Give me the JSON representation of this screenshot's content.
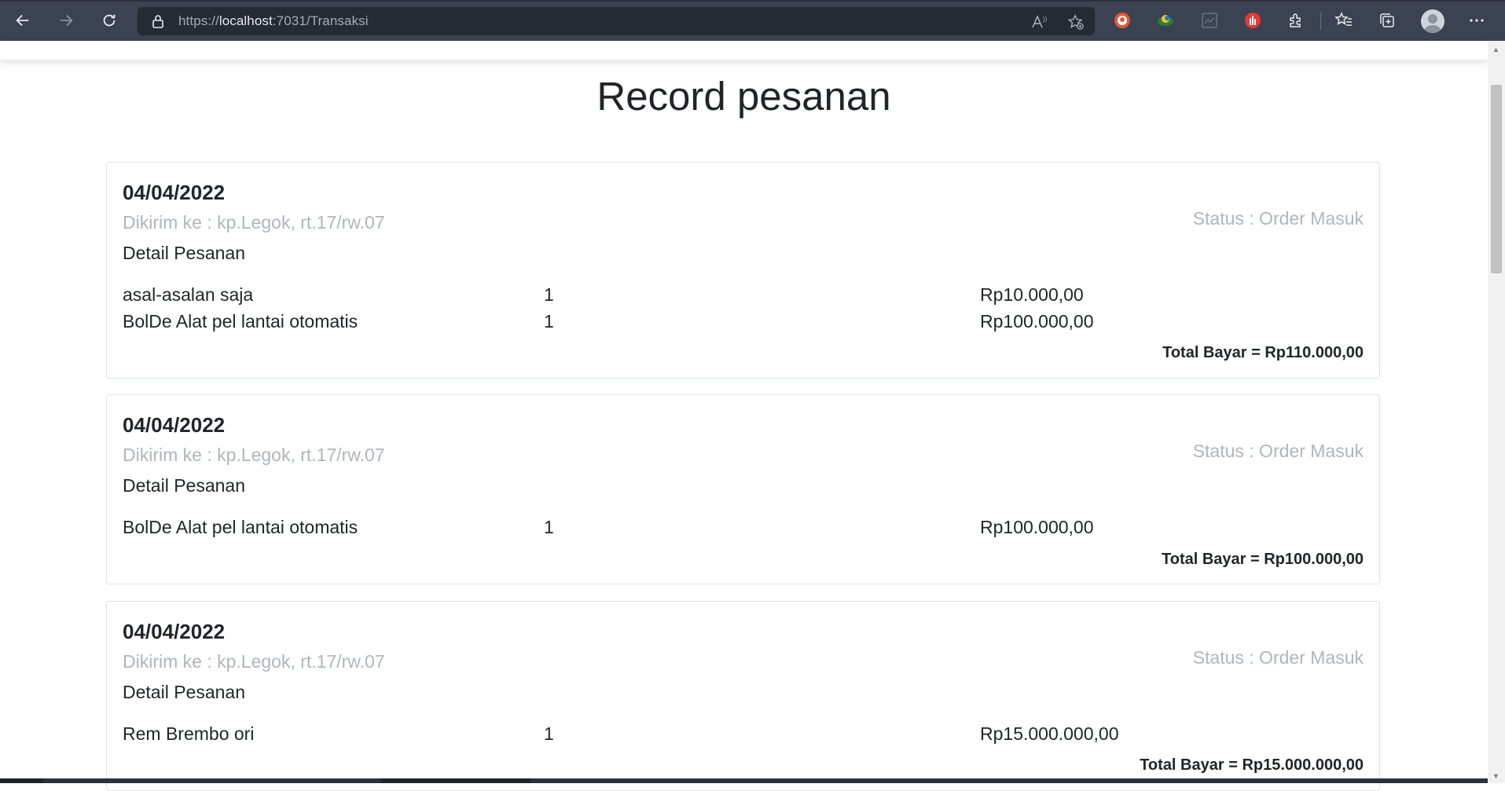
{
  "browser": {
    "url_prefix": "https://",
    "url_host": "localhost",
    "url_path": ":7031/Transaksi"
  },
  "page": {
    "title": "Record pesanan"
  },
  "orders": [
    {
      "date": "04/04/2022",
      "address": "Dikirim ke : kp.Legok, rt.17/rw.07",
      "status": "Status : Order Masuk",
      "detail_label": "Detail Pesanan",
      "items": [
        {
          "name": "asal-asalan saja",
          "qty": "1",
          "price": "Rp10.000,00"
        },
        {
          "name": "BolDe Alat pel lantai otomatis",
          "qty": "1",
          "price": "Rp100.000,00"
        }
      ],
      "total": "Total Bayar = Rp110.000,00"
    },
    {
      "date": "04/04/2022",
      "address": "Dikirim ke : kp.Legok, rt.17/rw.07",
      "status": "Status : Order Masuk",
      "detail_label": "Detail Pesanan",
      "items": [
        {
          "name": "BolDe Alat pel lantai otomatis",
          "qty": "1",
          "price": "Rp100.000,00"
        }
      ],
      "total": "Total Bayar = Rp100.000,00"
    },
    {
      "date": "04/04/2022",
      "address": "Dikirim ke : kp.Legok, rt.17/rw.07",
      "status": "Status : Order Masuk",
      "detail_label": "Detail Pesanan",
      "items": [
        {
          "name": "Rem Brembo ori",
          "qty": "1",
          "price": "Rp15.000.000,00"
        }
      ],
      "total": "Total Bayar = Rp15.000.000,00"
    }
  ],
  "icons": {
    "back": "arrow-left-icon",
    "forward": "arrow-right-icon",
    "refresh": "refresh-icon",
    "lock": "lock-icon",
    "read_aloud": "read-aloud-icon",
    "add_favorite": "star-plus-icon",
    "ext_duckduckgo": "duckduckgo-icon",
    "ext_globe": "globe-extension-icon",
    "ext_grid": "grid-extension-icon",
    "ext_hand": "hand-extension-icon",
    "extensions": "puzzle-icon",
    "favorites": "favorites-icon",
    "collections": "collections-icon",
    "profile": "profile-avatar-icon",
    "menu": "more-icon"
  }
}
